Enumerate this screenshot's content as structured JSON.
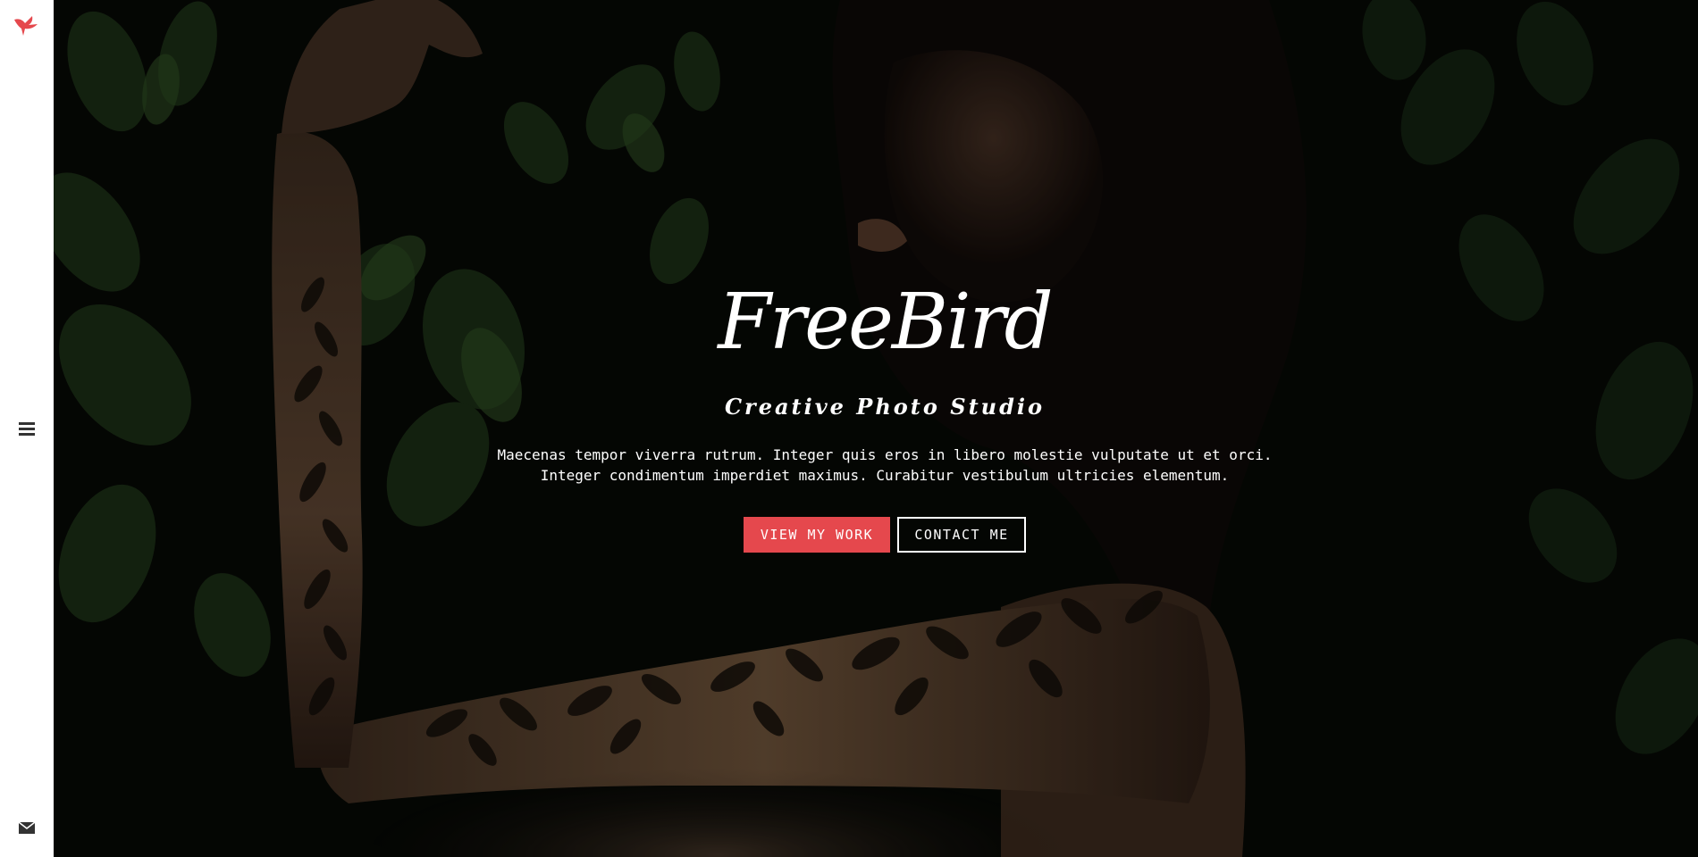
{
  "sidebar": {
    "logo_icon": "bird-icon",
    "menu_icon": "hamburger-menu-icon",
    "mail_icon": "envelope-icon"
  },
  "hero": {
    "title": "FreeBird",
    "subtitle": "Creative Photo Studio",
    "intro_line1": "Maecenas tempor viverra rutrum. Integer quis eros in libero molestie vulputate ut et orci.",
    "intro_line2": "Integer condimentum imperdiet maximus. Curabitur vestibulum ultricies elementum.",
    "primary_button": "VIEW MY WORK",
    "secondary_button": "CONTACT ME"
  },
  "colors": {
    "accent": "#e5484d",
    "sidebar_bg": "#ffffff",
    "text": "#ffffff"
  }
}
